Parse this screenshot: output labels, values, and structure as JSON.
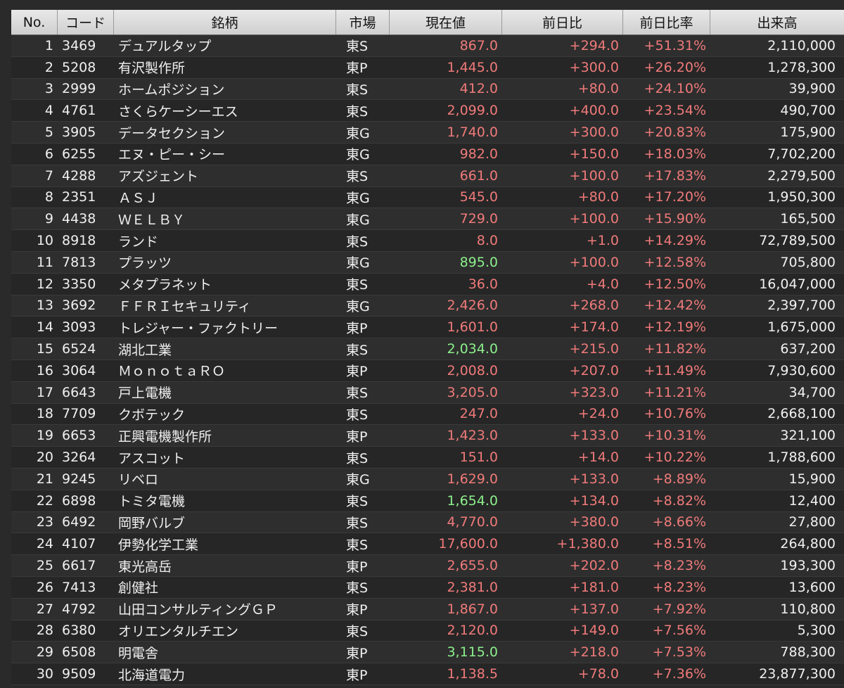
{
  "colors": {
    "up": "#f07a7a",
    "hit": "#8cf08c",
    "text": "#f0f0f0",
    "header_bg": "#dcdcdc"
  },
  "headers": [
    "No.",
    "コード",
    "銘柄",
    "市場",
    "現在値",
    "前日比",
    "前日比率",
    "出来高"
  ],
  "rows": [
    {
      "no": "1",
      "code": "3469",
      "name": "デュアルタップ",
      "market": "東S",
      "price": "867.0",
      "price_color": "red",
      "change": "+294.0",
      "pct": "+51.31%",
      "volume": "2,110,000"
    },
    {
      "no": "2",
      "code": "5208",
      "name": "有沢製作所",
      "market": "東P",
      "price": "1,445.0",
      "price_color": "red",
      "change": "+300.0",
      "pct": "+26.20%",
      "volume": "1,278,300"
    },
    {
      "no": "3",
      "code": "2999",
      "name": "ホームポジション",
      "market": "東S",
      "price": "412.0",
      "price_color": "red",
      "change": "+80.0",
      "pct": "+24.10%",
      "volume": "39,900"
    },
    {
      "no": "4",
      "code": "4761",
      "name": "さくらケーシーエス",
      "market": "東S",
      "price": "2,099.0",
      "price_color": "red",
      "change": "+400.0",
      "pct": "+23.54%",
      "volume": "490,700"
    },
    {
      "no": "5",
      "code": "3905",
      "name": "データセクション",
      "market": "東G",
      "price": "1,740.0",
      "price_color": "red",
      "change": "+300.0",
      "pct": "+20.83%",
      "volume": "175,900"
    },
    {
      "no": "6",
      "code": "6255",
      "name": "エヌ・ピー・シー",
      "market": "東G",
      "price": "982.0",
      "price_color": "red",
      "change": "+150.0",
      "pct": "+18.03%",
      "volume": "7,702,200"
    },
    {
      "no": "7",
      "code": "4288",
      "name": "アズジェント",
      "market": "東S",
      "price": "661.0",
      "price_color": "red",
      "change": "+100.0",
      "pct": "+17.83%",
      "volume": "2,279,500"
    },
    {
      "no": "8",
      "code": "2351",
      "name": "ＡＳＪ",
      "market": "東G",
      "price": "545.0",
      "price_color": "red",
      "change": "+80.0",
      "pct": "+17.20%",
      "volume": "1,950,300"
    },
    {
      "no": "9",
      "code": "4438",
      "name": "ＷＥＬＢＹ",
      "market": "東G",
      "price": "729.0",
      "price_color": "red",
      "change": "+100.0",
      "pct": "+15.90%",
      "volume": "165,500"
    },
    {
      "no": "10",
      "code": "8918",
      "name": "ランド",
      "market": "東S",
      "price": "8.0",
      "price_color": "red",
      "change": "+1.0",
      "pct": "+14.29%",
      "volume": "72,789,500"
    },
    {
      "no": "11",
      "code": "7813",
      "name": "プラッツ",
      "market": "東G",
      "price": "895.0",
      "price_color": "green",
      "change": "+100.0",
      "pct": "+12.58%",
      "volume": "705,800"
    },
    {
      "no": "12",
      "code": "3350",
      "name": "メタプラネット",
      "market": "東S",
      "price": "36.0",
      "price_color": "red",
      "change": "+4.0",
      "pct": "+12.50%",
      "volume": "16,047,000"
    },
    {
      "no": "13",
      "code": "3692",
      "name": "ＦＦＲＩセキュリティ",
      "market": "東G",
      "price": "2,426.0",
      "price_color": "red",
      "change": "+268.0",
      "pct": "+12.42%",
      "volume": "2,397,700"
    },
    {
      "no": "14",
      "code": "3093",
      "name": "トレジャー・ファクトリー",
      "market": "東P",
      "price": "1,601.0",
      "price_color": "red",
      "change": "+174.0",
      "pct": "+12.19%",
      "volume": "1,675,000"
    },
    {
      "no": "15",
      "code": "6524",
      "name": "湖北工業",
      "market": "東S",
      "price": "2,034.0",
      "price_color": "green",
      "change": "+215.0",
      "pct": "+11.82%",
      "volume": "637,200"
    },
    {
      "no": "16",
      "code": "3064",
      "name": "ＭｏｎｏｔａＲＯ",
      "market": "東P",
      "price": "2,008.0",
      "price_color": "red",
      "change": "+207.0",
      "pct": "+11.49%",
      "volume": "7,930,600"
    },
    {
      "no": "17",
      "code": "6643",
      "name": "戸上電機",
      "market": "東S",
      "price": "3,205.0",
      "price_color": "red",
      "change": "+323.0",
      "pct": "+11.21%",
      "volume": "34,700"
    },
    {
      "no": "18",
      "code": "7709",
      "name": "クボテック",
      "market": "東S",
      "price": "247.0",
      "price_color": "red",
      "change": "+24.0",
      "pct": "+10.76%",
      "volume": "2,668,100"
    },
    {
      "no": "19",
      "code": "6653",
      "name": "正興電機製作所",
      "market": "東P",
      "price": "1,423.0",
      "price_color": "red",
      "change": "+133.0",
      "pct": "+10.31%",
      "volume": "321,100"
    },
    {
      "no": "20",
      "code": "3264",
      "name": "アスコット",
      "market": "東S",
      "price": "151.0",
      "price_color": "red",
      "change": "+14.0",
      "pct": "+10.22%",
      "volume": "1,788,600"
    },
    {
      "no": "21",
      "code": "9245",
      "name": "リベロ",
      "market": "東G",
      "price": "1,629.0",
      "price_color": "red",
      "change": "+133.0",
      "pct": "+8.89%",
      "volume": "15,900"
    },
    {
      "no": "22",
      "code": "6898",
      "name": "トミタ電機",
      "market": "東S",
      "price": "1,654.0",
      "price_color": "green",
      "change": "+134.0",
      "pct": "+8.82%",
      "volume": "12,400"
    },
    {
      "no": "23",
      "code": "6492",
      "name": "岡野バルブ",
      "market": "東S",
      "price": "4,770.0",
      "price_color": "red",
      "change": "+380.0",
      "pct": "+8.66%",
      "volume": "27,800"
    },
    {
      "no": "24",
      "code": "4107",
      "name": "伊勢化学工業",
      "market": "東S",
      "price": "17,600.0",
      "price_color": "red",
      "change": "+1,380.0",
      "pct": "+8.51%",
      "volume": "264,800"
    },
    {
      "no": "25",
      "code": "6617",
      "name": "東光高岳",
      "market": "東P",
      "price": "2,655.0",
      "price_color": "red",
      "change": "+202.0",
      "pct": "+8.23%",
      "volume": "193,300"
    },
    {
      "no": "26",
      "code": "7413",
      "name": "創健社",
      "market": "東S",
      "price": "2,381.0",
      "price_color": "red",
      "change": "+181.0",
      "pct": "+8.23%",
      "volume": "13,600"
    },
    {
      "no": "27",
      "code": "4792",
      "name": "山田コンサルティングＧＰ",
      "market": "東P",
      "price": "1,867.0",
      "price_color": "red",
      "change": "+137.0",
      "pct": "+7.92%",
      "volume": "110,800"
    },
    {
      "no": "28",
      "code": "6380",
      "name": "オリエンタルチエン",
      "market": "東S",
      "price": "2,120.0",
      "price_color": "red",
      "change": "+149.0",
      "pct": "+7.56%",
      "volume": "5,300"
    },
    {
      "no": "29",
      "code": "6508",
      "name": "明電舎",
      "market": "東P",
      "price": "3,115.0",
      "price_color": "green",
      "change": "+218.0",
      "pct": "+7.53%",
      "volume": "788,300"
    },
    {
      "no": "30",
      "code": "9509",
      "name": "北海道電力",
      "market": "東P",
      "price": "1,138.5",
      "price_color": "red",
      "change": "+78.0",
      "pct": "+7.36%",
      "volume": "23,877,300"
    }
  ]
}
